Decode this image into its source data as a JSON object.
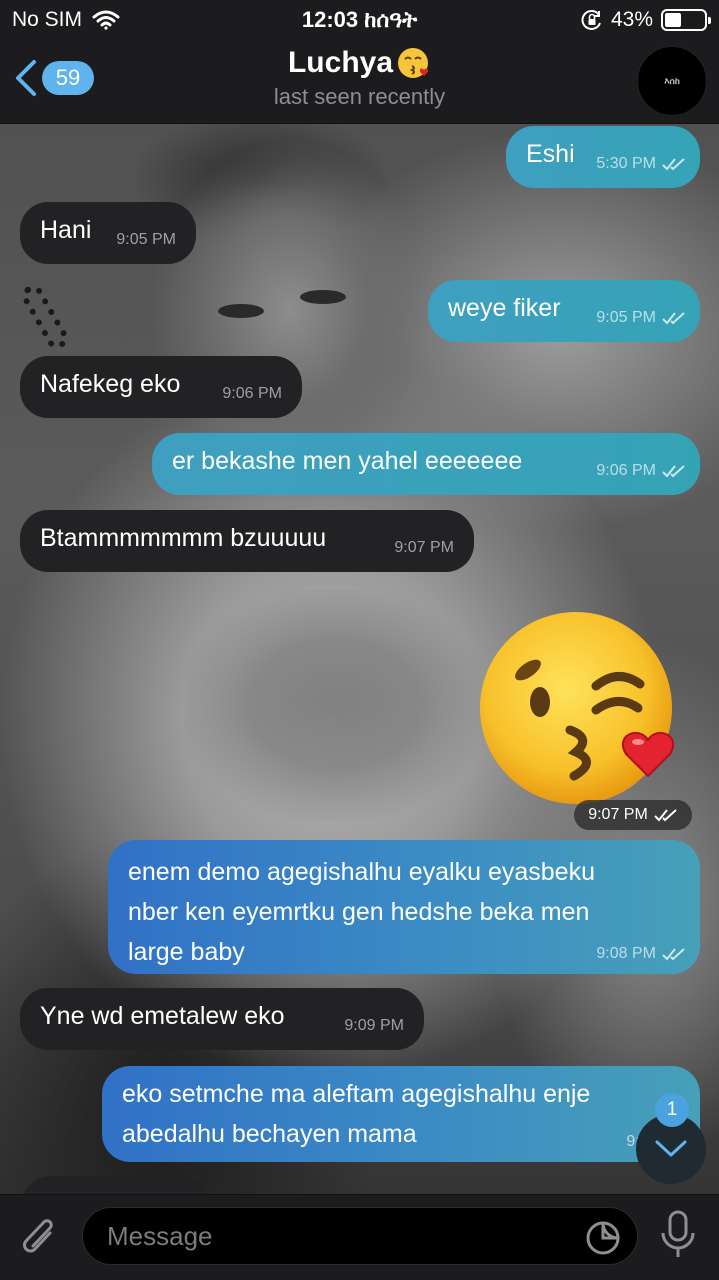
{
  "status_bar": {
    "carrier": "No SIM",
    "time": "12:03 ከሰዓት",
    "battery": "43%",
    "battery_level": 0.43
  },
  "header": {
    "back_count": "59",
    "title": "Luchya",
    "title_emoji": "face-blowing-kiss",
    "status": "last seen recently",
    "avatar_text": "እሰከ"
  },
  "messages": [
    {
      "direction": "out",
      "text": "Eshi",
      "time": "5:30 PM",
      "read": true
    },
    {
      "direction": "in",
      "text": "Hani",
      "time": "9:05 PM"
    },
    {
      "direction": "out",
      "text": "weye fiker",
      "time": "9:05 PM",
      "read": true
    },
    {
      "direction": "in",
      "text": "Nafekeg eko",
      "time": "9:06 PM"
    },
    {
      "direction": "out",
      "text": "er bekashe men yahel eeeeeee",
      "time": "9:06 PM",
      "read": true
    },
    {
      "direction": "in",
      "text": "Btammmmmmm bzuuuuu",
      "time": "9:07 PM"
    },
    {
      "direction": "out",
      "type": "sticker",
      "sticker": "face-blowing-kiss",
      "time": "9:07 PM",
      "read": true
    },
    {
      "direction": "out",
      "lines": [
        "enem demo agegishalhu eyalku eyasbeku",
        "nber ken eyemrtku gen hedshe beka men",
        "large baby"
      ],
      "time": "9:08 PM",
      "read": true
    },
    {
      "direction": "in",
      "text": "Yne wd emetalew eko",
      "time": "9:09 PM"
    },
    {
      "direction": "out",
      "lines": [
        "eko setmche ma aleftam agegishalhu enje",
        "abedalhu bechayen mama"
      ],
      "time": "9:09 PM",
      "read": true
    }
  ],
  "scroll_button": {
    "unread": "1"
  },
  "input": {
    "placeholder": "Message"
  },
  "colors": {
    "bubble_in": "#222224",
    "bubble_out": "#3f9fc0",
    "accent": "#5fb4ee",
    "bar_bg": "#1c1c1e"
  }
}
